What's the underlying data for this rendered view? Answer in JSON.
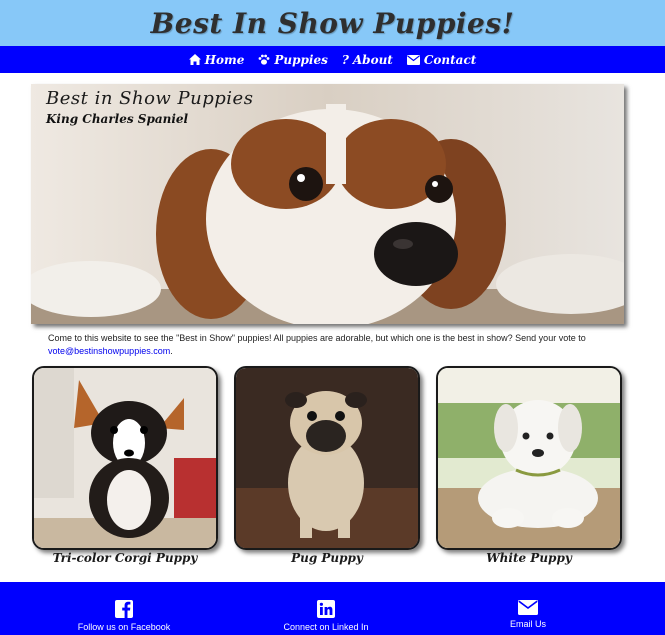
{
  "header": {
    "site_title": "Best In Show Puppies!"
  },
  "nav": {
    "items": [
      {
        "label": "Home",
        "icon": "home-icon"
      },
      {
        "label": "Puppies",
        "icon": "paw-icon"
      },
      {
        "label": "About",
        "icon": "question-icon"
      },
      {
        "label": "Contact",
        "icon": "envelope-icon"
      }
    ]
  },
  "hero": {
    "title": "Best in Show Puppies",
    "subtitle": "King Charles Spaniel"
  },
  "intro": {
    "text": "Come to this website to see the \"Best in Show\" puppies! All puppies are adorable, but which one is the best in show? Send your vote to",
    "email": "vote@bestinshowpuppies.com",
    "suffix": "."
  },
  "cards": [
    {
      "caption": "Tri-color Corgi Puppy"
    },
    {
      "caption": "Pug Puppy"
    },
    {
      "caption": "White Puppy"
    }
  ],
  "footer": {
    "links": [
      {
        "label": "Follow us on Facebook",
        "icon": "facebook-icon"
      },
      {
        "label": "Connect on Linked In",
        "icon": "linkedin-icon"
      },
      {
        "label": "Email Us",
        "icon": "envelope-icon"
      }
    ]
  },
  "colors": {
    "header_bg": "#87c8f8",
    "nav_bg": "#0000ff",
    "footer_bg": "#0000ff",
    "link": "#0000ee"
  }
}
